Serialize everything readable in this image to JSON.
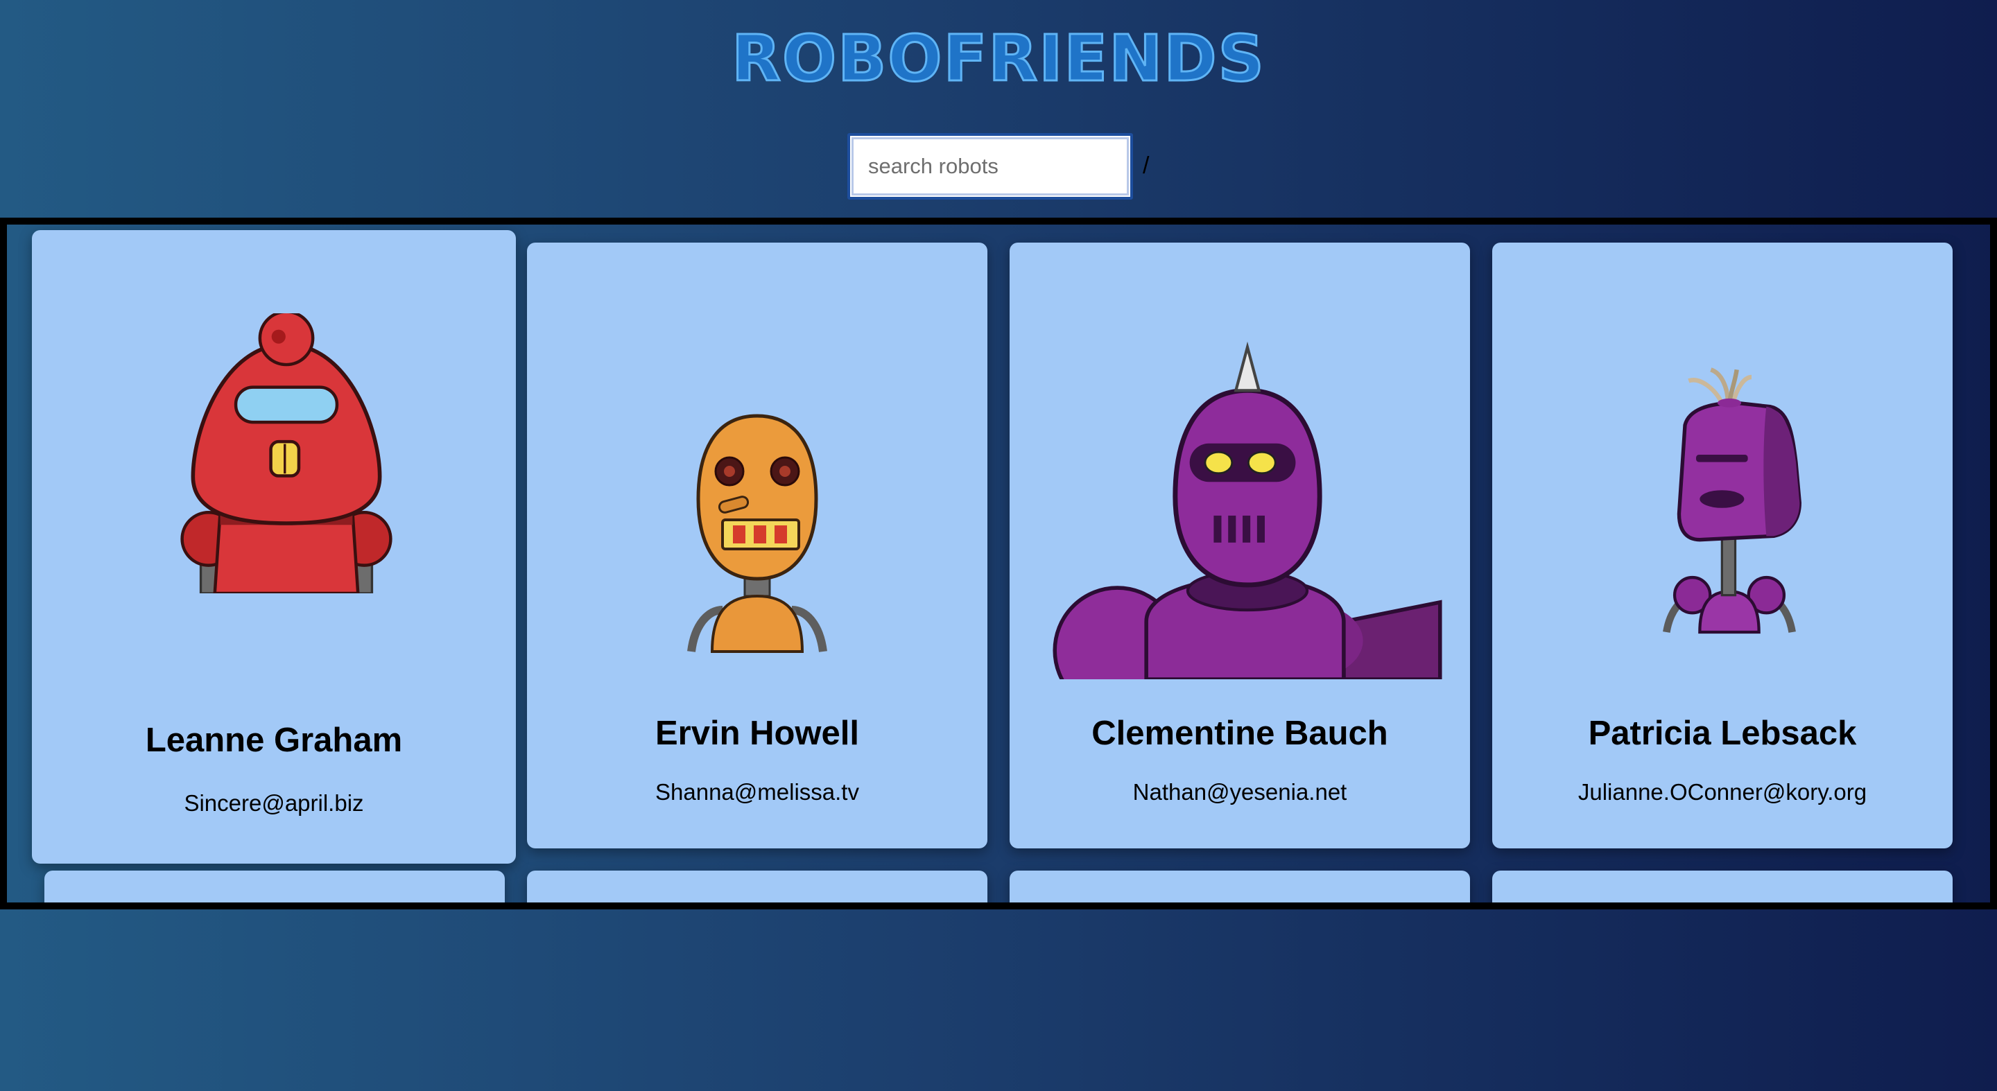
{
  "header": {
    "title": "ROBOFRIENDS"
  },
  "search": {
    "placeholder": "search robots",
    "trailing_text": "/"
  },
  "robots": [
    {
      "name": "Leanne Graham",
      "email": "Sincere@april.biz",
      "avatar": "red-robot"
    },
    {
      "name": "Ervin Howell",
      "email": "Shanna@melissa.tv",
      "avatar": "orange-robot"
    },
    {
      "name": "Clementine Bauch",
      "email": "Nathan@yesenia.net",
      "avatar": "purple-horned-robot"
    },
    {
      "name": "Patricia Lebsack",
      "email": "Julianne.OConner@kory.org",
      "avatar": "purple-box-robot"
    }
  ],
  "colors": {
    "card_bg": "#a2c9f7",
    "title_fill": "#1f74c8",
    "title_stroke": "#5fb4f5"
  }
}
